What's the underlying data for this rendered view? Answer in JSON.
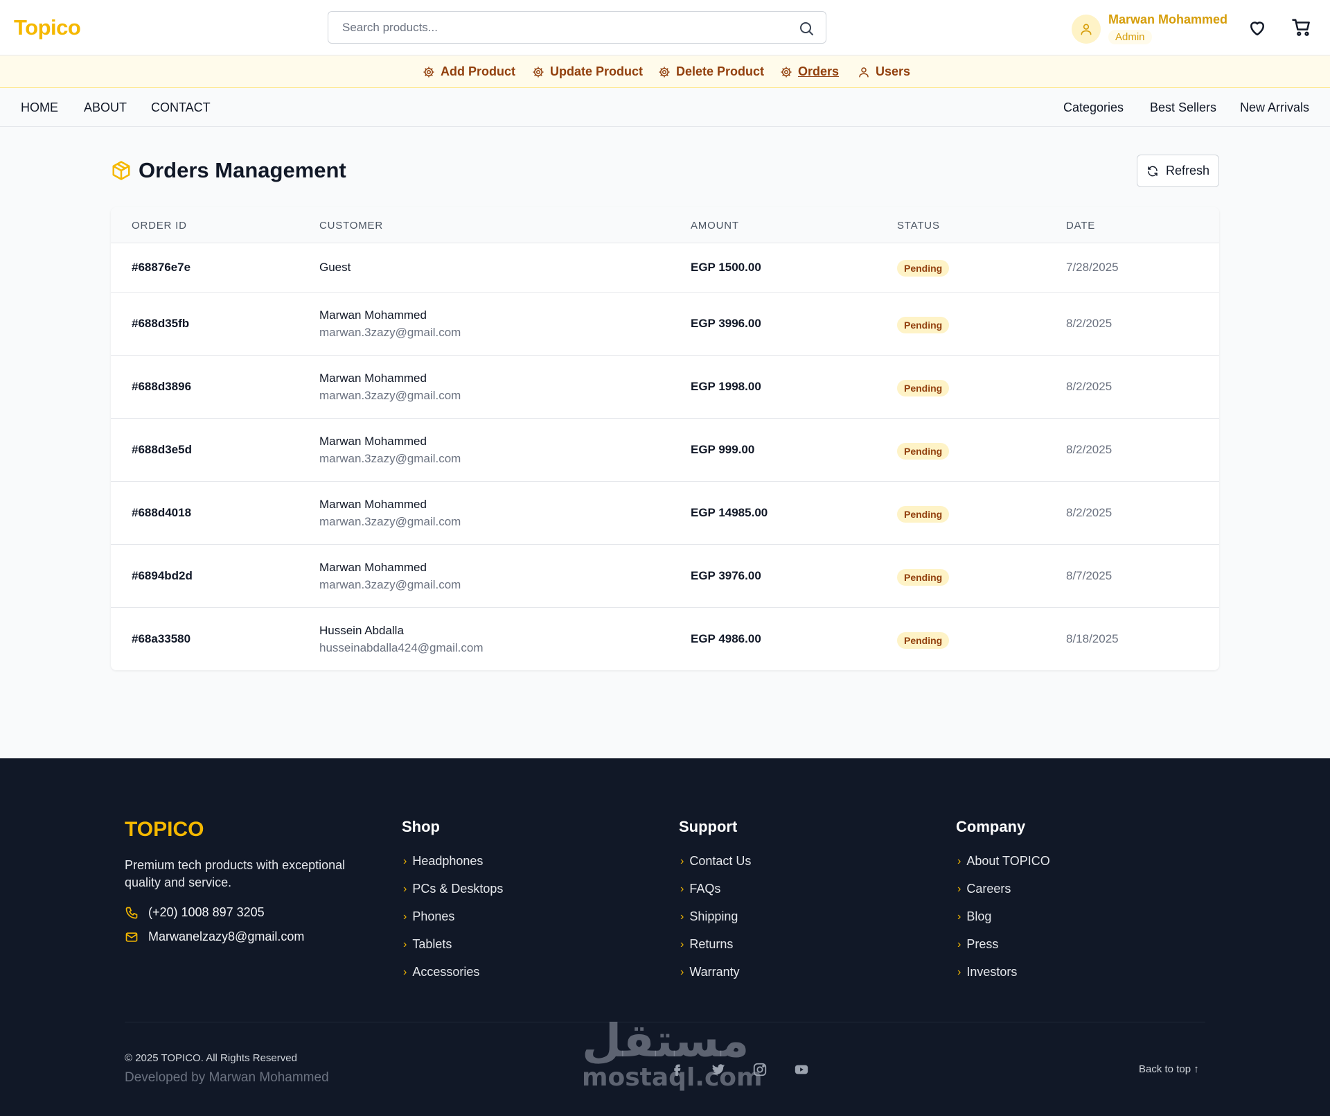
{
  "header": {
    "logo": "Topico",
    "search_placeholder": "Search products...",
    "user_name": "Marwan Mohammed",
    "user_role": "Admin"
  },
  "admin_nav": [
    {
      "label": "Add Product",
      "icon": "gear-icon"
    },
    {
      "label": "Update Product",
      "icon": "gear-icon"
    },
    {
      "label": "Delete Product",
      "icon": "gear-icon"
    },
    {
      "label": "Orders",
      "icon": "gear-icon",
      "active": true
    },
    {
      "label": "Users",
      "icon": "user-icon"
    }
  ],
  "main_nav": {
    "left": [
      "HOME",
      "ABOUT",
      "CONTACT"
    ],
    "right": [
      "Categories",
      "Best Sellers",
      "New Arrivals"
    ]
  },
  "page": {
    "title": "Orders Management",
    "refresh_label": "Refresh"
  },
  "table": {
    "columns": [
      "ORDER ID",
      "CUSTOMER",
      "AMOUNT",
      "STATUS",
      "DATE"
    ],
    "rows": [
      {
        "id": "#68876e7e",
        "name": "Guest",
        "email": "",
        "amount": "EGP 1500.00",
        "status": "Pending",
        "date": "7/28/2025"
      },
      {
        "id": "#688d35fb",
        "name": "Marwan Mohammed",
        "email": "marwan.3zazy@gmail.com",
        "amount": "EGP 3996.00",
        "status": "Pending",
        "date": "8/2/2025"
      },
      {
        "id": "#688d3896",
        "name": "Marwan Mohammed",
        "email": "marwan.3zazy@gmail.com",
        "amount": "EGP 1998.00",
        "status": "Pending",
        "date": "8/2/2025"
      },
      {
        "id": "#688d3e5d",
        "name": "Marwan Mohammed",
        "email": "marwan.3zazy@gmail.com",
        "amount": "EGP 999.00",
        "status": "Pending",
        "date": "8/2/2025"
      },
      {
        "id": "#688d4018",
        "name": "Marwan Mohammed",
        "email": "marwan.3zazy@gmail.com",
        "amount": "EGP 14985.00",
        "status": "Pending",
        "date": "8/2/2025"
      },
      {
        "id": "#6894bd2d",
        "name": "Marwan Mohammed",
        "email": "marwan.3zazy@gmail.com",
        "amount": "EGP 3976.00",
        "status": "Pending",
        "date": "8/7/2025"
      },
      {
        "id": "#68a33580",
        "name": "Hussein Abdalla",
        "email": "husseinabdalla424@gmail.com",
        "amount": "EGP 4986.00",
        "status": "Pending",
        "date": "8/18/2025"
      }
    ]
  },
  "footer": {
    "brand": "TOPICO",
    "description": "Premium tech products with exceptional quality and service.",
    "phone": "(+20) 1008 897 3205",
    "email": "Marwanelzazy8@gmail.com",
    "columns": [
      {
        "title": "Shop",
        "links": [
          "Headphones",
          "PCs & Desktops",
          "Phones",
          "Tablets",
          "Accessories"
        ]
      },
      {
        "title": "Support",
        "links": [
          "Contact Us",
          "FAQs",
          "Shipping",
          "Returns",
          "Warranty"
        ]
      },
      {
        "title": "Company",
        "links": [
          "About TOPICO",
          "Careers",
          "Blog",
          "Press",
          "Investors"
        ]
      }
    ],
    "copyright": "© 2025 TOPICO. All Rights Reserved",
    "developer": "Developed by Marwan Mohammed",
    "back_to_top": "Back to top ↑",
    "social_icons": [
      "facebook-icon",
      "twitter-icon",
      "instagram-icon",
      "youtube-icon"
    ],
    "watermark_ar": "مستقل",
    "watermark_en": "mostaql.com"
  },
  "colors": {
    "brand": "#f5b800",
    "admin_bar_bg": "#fffbeb",
    "admin_text": "#92400e",
    "footer_bg": "#111827",
    "status_pending_bg": "#fef3c7"
  }
}
